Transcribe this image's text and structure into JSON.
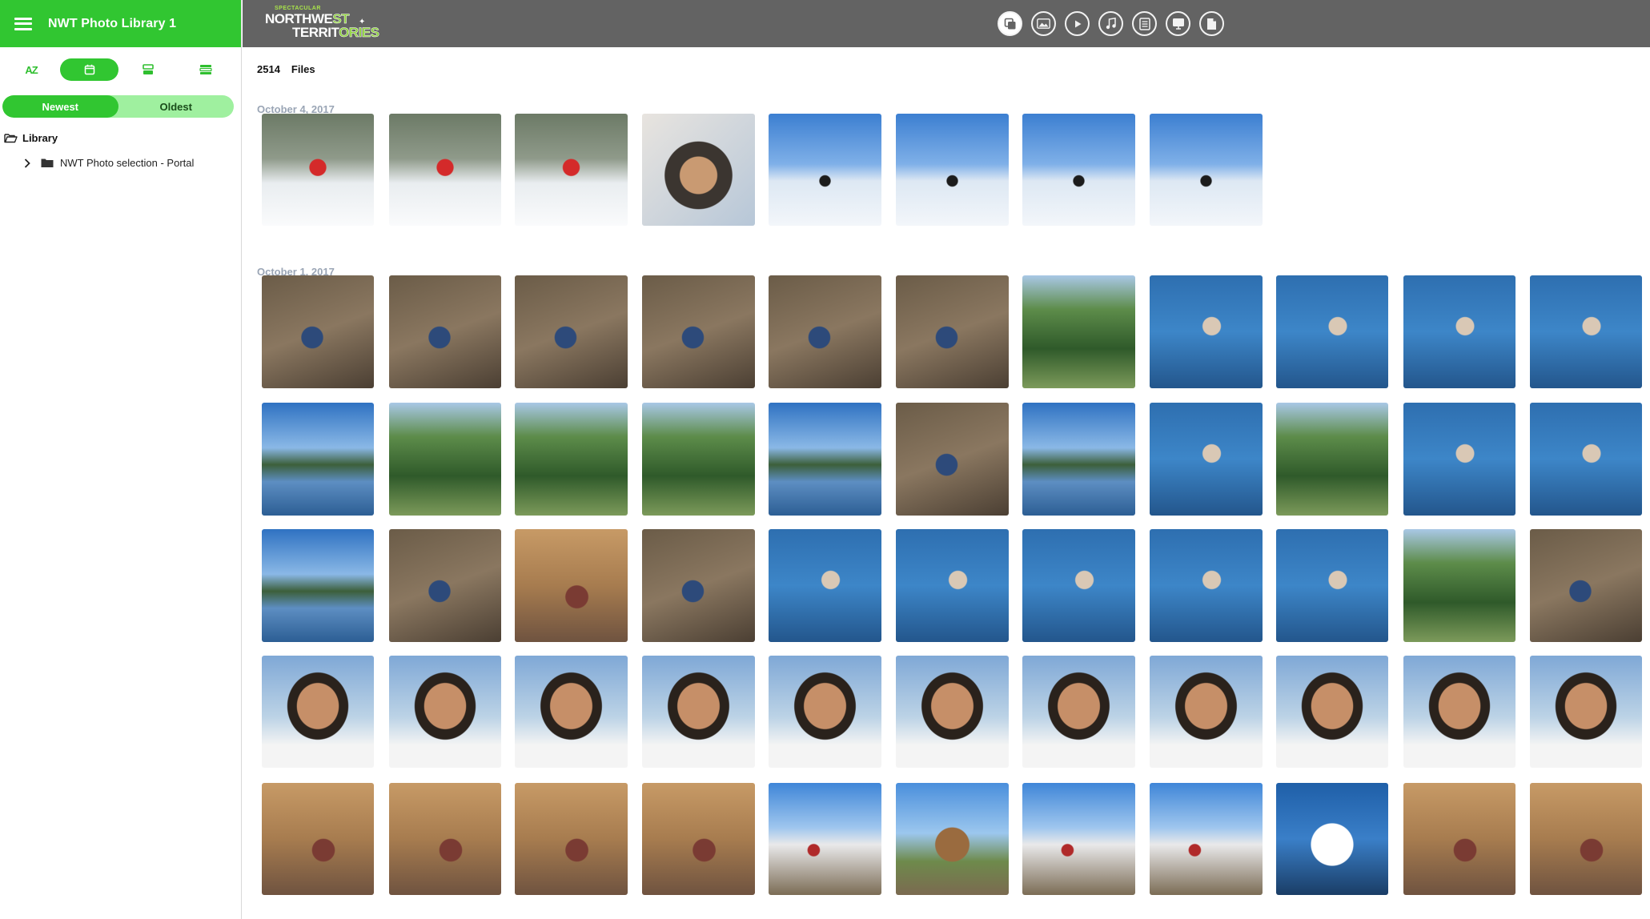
{
  "app": {
    "title": "NWT Photo Library 1"
  },
  "sidebar": {
    "view_modes": [
      {
        "name": "alphabetical",
        "label": "AZ"
      },
      {
        "name": "date",
        "icon": "calendar-icon",
        "active": true
      },
      {
        "name": "stacked",
        "icon": "stack-icon"
      },
      {
        "name": "list",
        "icon": "list-icon"
      }
    ],
    "sort": {
      "newest": "Newest",
      "oldest": "Oldest",
      "active": "newest"
    },
    "tree": {
      "root": "Library",
      "items": [
        {
          "label": "NWT Photo selection - Portal"
        }
      ]
    }
  },
  "topbar": {
    "logo": {
      "line_top": "SPECTACULAR",
      "line1a": "NORTHWE",
      "line1b": "ST",
      "line2a": "TERRIT",
      "line2b": "ORIES"
    },
    "type_filters": [
      {
        "icon": "all-files-icon",
        "active": true
      },
      {
        "icon": "photo-icon"
      },
      {
        "icon": "video-icon"
      },
      {
        "icon": "music-icon"
      },
      {
        "icon": "document-icon"
      },
      {
        "icon": "presentation-icon"
      },
      {
        "icon": "file-icon"
      }
    ]
  },
  "main": {
    "count": "2514",
    "count_label": "Files",
    "groups": [
      {
        "date": "October 4, 2017",
        "photos": [
          "snow-forest-red",
          "snow-forest-red",
          "snow-forest-red",
          "portrait-helmet",
          "snow-ice",
          "snow-ice",
          "snow-ice",
          "snow-ice"
        ]
      },
      {
        "date": "October 1, 2017",
        "photos": [
          "camp-earth",
          "camp-earth",
          "camp-earth",
          "camp-earth",
          "camp-earth",
          "camp-earth",
          "forest",
          "lake-fishing",
          "lake-fishing",
          "lake-fishing",
          "lake-fishing",
          "lake-sky",
          "forest",
          "forest",
          "forest",
          "lake-sky",
          "camp-earth",
          "lake-sky",
          "lake-fishing",
          "forest",
          "lake-fishing",
          "lake-fishing",
          "lake-sky",
          "camp-earth",
          "cabin-interior",
          "camp-earth",
          "lake-fishing",
          "lake-fishing",
          "lake-fishing",
          "lake-fishing",
          "lake-fishing",
          "forest",
          "camp-earth",
          "portrait",
          "portrait",
          "portrait",
          "portrait",
          "portrait",
          "portrait",
          "portrait",
          "portrait",
          "portrait",
          "portrait",
          "portrait",
          "cabin-interior",
          "cabin-interior",
          "cabin-interior",
          "cabin-interior",
          "outdoor-crowd",
          "cabin-exterior",
          "outdoor-crowd",
          "outdoor-crowd",
          "painted-truck",
          "cabin-interior",
          "cabin-interior"
        ]
      }
    ]
  },
  "colors": {
    "accent": "#31c631",
    "accent_light": "#9ff09f",
    "topbar": "#636363",
    "date_label": "#9aa5b5"
  }
}
